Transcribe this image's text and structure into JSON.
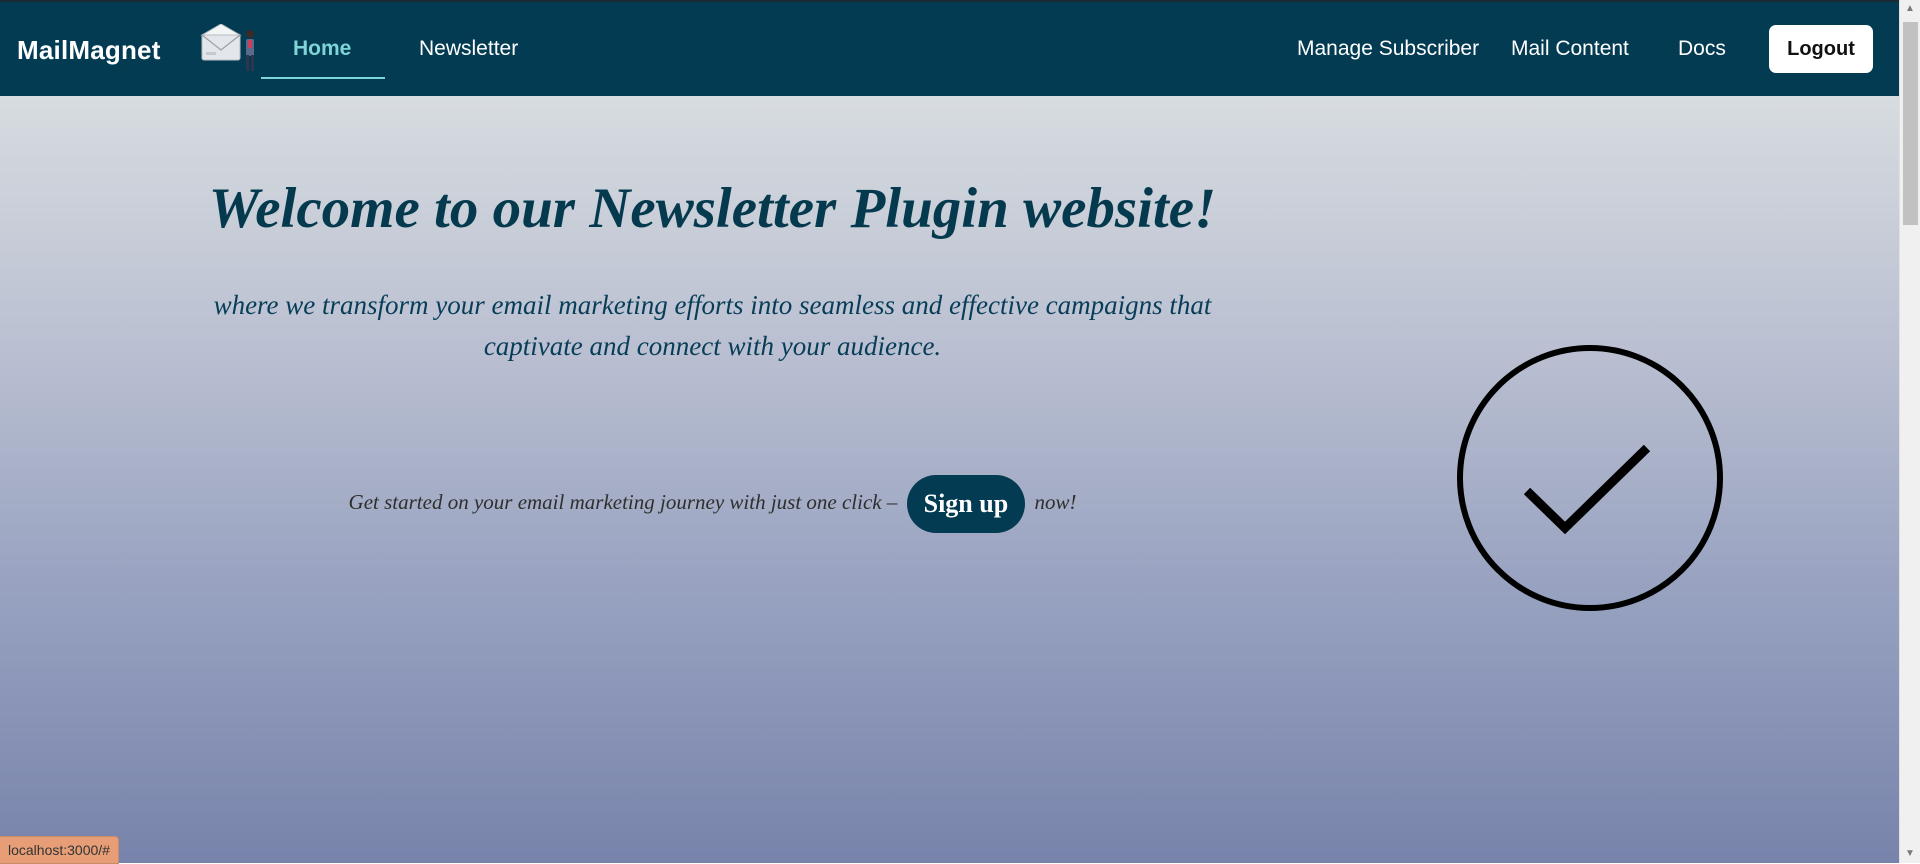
{
  "navbar": {
    "brand": "MailMagnet",
    "logo_icon": "envelope-person-icon",
    "links": {
      "home": "Home",
      "newsletter": "Newsletter",
      "manage_subscriber": "Manage Subscriber",
      "mail_content": "Mail Content",
      "docs": "Docs"
    },
    "logout_label": "Logout",
    "background_color": "#033b52",
    "active_color": "#7fd4d8"
  },
  "hero": {
    "title": "Welcome to our Newsletter Plugin website!",
    "subtitle": "where we transform your email marketing efforts into seamless and effective campaigns that captivate and connect with your audience.",
    "cta_prefix": "Get started on your email marketing journey with just one click –",
    "signup_label": "Sign up",
    "cta_suffix": "now!",
    "graphic_icon": "check-circle-icon"
  },
  "status_bar": {
    "url": "localhost:3000/#"
  }
}
